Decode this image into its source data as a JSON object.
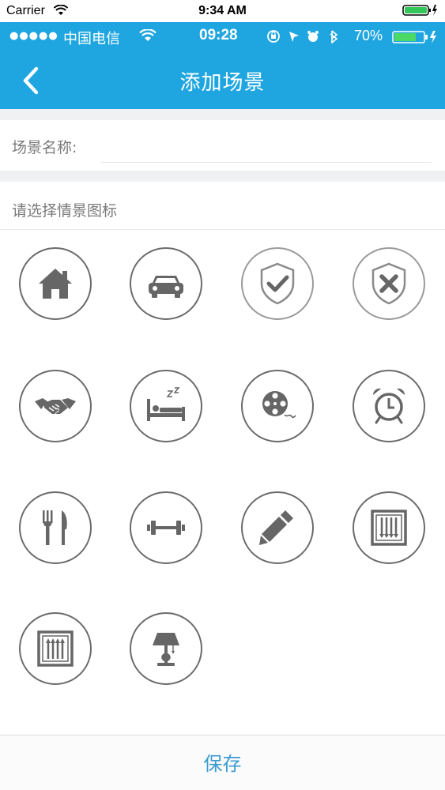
{
  "simulator_status": {
    "carrier": "Carrier",
    "time": "9:34 AM"
  },
  "app_status": {
    "signal_dots": "●●●●●",
    "carrier": "中国电信",
    "time": "09:28",
    "battery_percent": "70%"
  },
  "nav": {
    "title": "添加场景"
  },
  "form": {
    "name_label": "场景名称:",
    "name_value": "",
    "icon_section_title": "请选择情景图标"
  },
  "icons": [
    "home-icon",
    "car-icon",
    "shield-check-icon",
    "shield-cross-icon",
    "handshake-icon",
    "sleep-bed-icon",
    "film-reel-icon",
    "alarm-clock-icon",
    "fork-knife-icon",
    "dumbbell-icon",
    "pencil-icon",
    "curtain-close-icon",
    "curtain-open-icon",
    "lamp-icon"
  ],
  "bottom": {
    "save_label": "保存"
  },
  "colors": {
    "header_bg": "#1fa6e0",
    "icon_stroke": "#6b6b6b",
    "save_text": "#3b9bd1"
  }
}
